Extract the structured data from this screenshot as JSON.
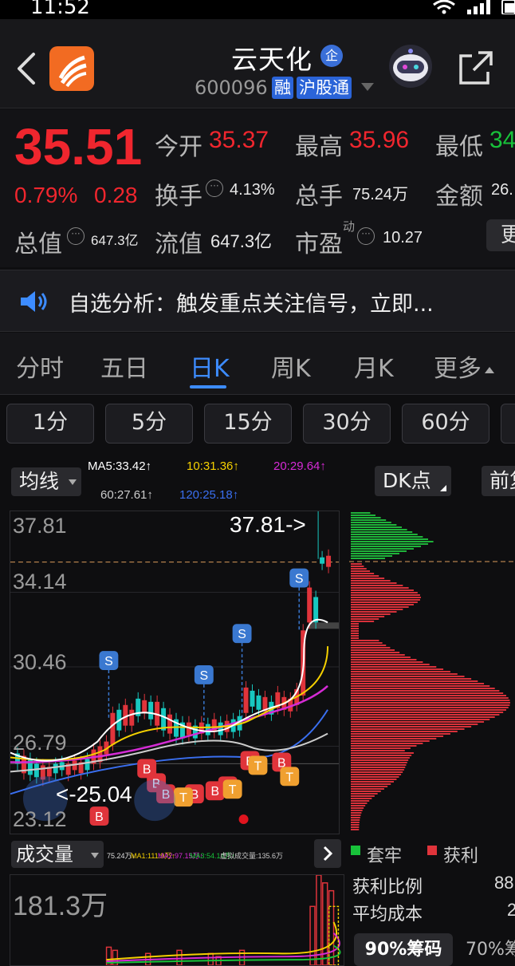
{
  "status": {
    "time": "11:52"
  },
  "header": {
    "title": "云天化",
    "enterprise_badge": "企",
    "code": "600096",
    "tag_margin": "融",
    "tag_connect": "沪股通"
  },
  "quote": {
    "price": "35.51",
    "change_pct": "0.79%",
    "change_abs": "0.28",
    "open_label": "今开",
    "open_value": "35.37",
    "high_label": "最高",
    "high_value": "35.96",
    "low_label": "最低",
    "low_value": "34",
    "turnover_label": "换手",
    "turnover_value": "4.13%",
    "volume_label": "总手",
    "volume_value": "75.24万",
    "amount_label": "金额",
    "amount_value": "26.",
    "mktcap_label": "总值",
    "mktcap_value": "647.3亿",
    "float_label": "流值",
    "float_value": "647.3亿",
    "pe_label": "市盈",
    "pe_sup": "动",
    "pe_value": "10.27",
    "more_label": "更",
    "colors": {
      "up": "#f0262e",
      "down": "#18c23a"
    }
  },
  "notice": {
    "text": "自选分析：触发重点关注信号，立即..."
  },
  "tabs": [
    {
      "label": "分时"
    },
    {
      "label": "五日"
    },
    {
      "label": "日K"
    },
    {
      "label": "周K"
    },
    {
      "label": "月K"
    },
    {
      "label": "更多"
    }
  ],
  "active_tab": "日K",
  "periods": [
    "1分",
    "5分",
    "15分",
    "30分",
    "60分"
  ],
  "ma": {
    "selector": "均线",
    "ma5": "MA5:33.42↑",
    "ma10": "10:31.36↑",
    "ma20": "20:29.64↑",
    "ma60": "60:27.61↑",
    "ma120": "120:25.18↑",
    "dk_button": "DK点",
    "prev_button": "前复",
    "colors": {
      "ma5": "#ffffff",
      "ma10": "#f5d000",
      "ma20": "#d62bd6",
      "ma60": "#cccccc",
      "ma120": "#3a6ff0"
    }
  },
  "kchart": {
    "y_labels": [
      "37.81",
      "34.14",
      "30.46",
      "26.79",
      "23.12"
    ],
    "high_annotation": "37.81->",
    "low_annotation": "<-25.04"
  },
  "volume": {
    "selector": "成交量",
    "ma_text": [
      "75.24万↓",
      "MA1:111.9万↑",
      "MA2:97.15万↑",
      "MA3:54.14万↑",
      "虚拟成交量:135.6万"
    ],
    "y_label": "181.3万"
  },
  "chips": {
    "legend_trapped": "套牢",
    "legend_profit": "获利",
    "profit_ratio_label": "获利比例",
    "profit_ratio_value": "88",
    "avg_cost_label": "平均成本",
    "avg_cost_value": "2",
    "tab_90": "90%筹码",
    "tab_70": "70%筹"
  }
}
